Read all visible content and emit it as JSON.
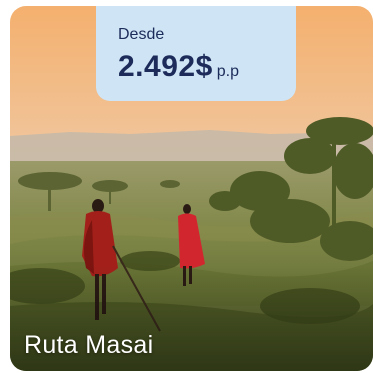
{
  "card": {
    "price": {
      "from_label": "Desde",
      "amount": "2.492$",
      "unit": "p.p"
    },
    "title": "Ruta Masai"
  },
  "colors": {
    "badge_bg": "#cfe5f5",
    "badge_text": "#1c2b5a",
    "title_text": "#ffffff"
  }
}
